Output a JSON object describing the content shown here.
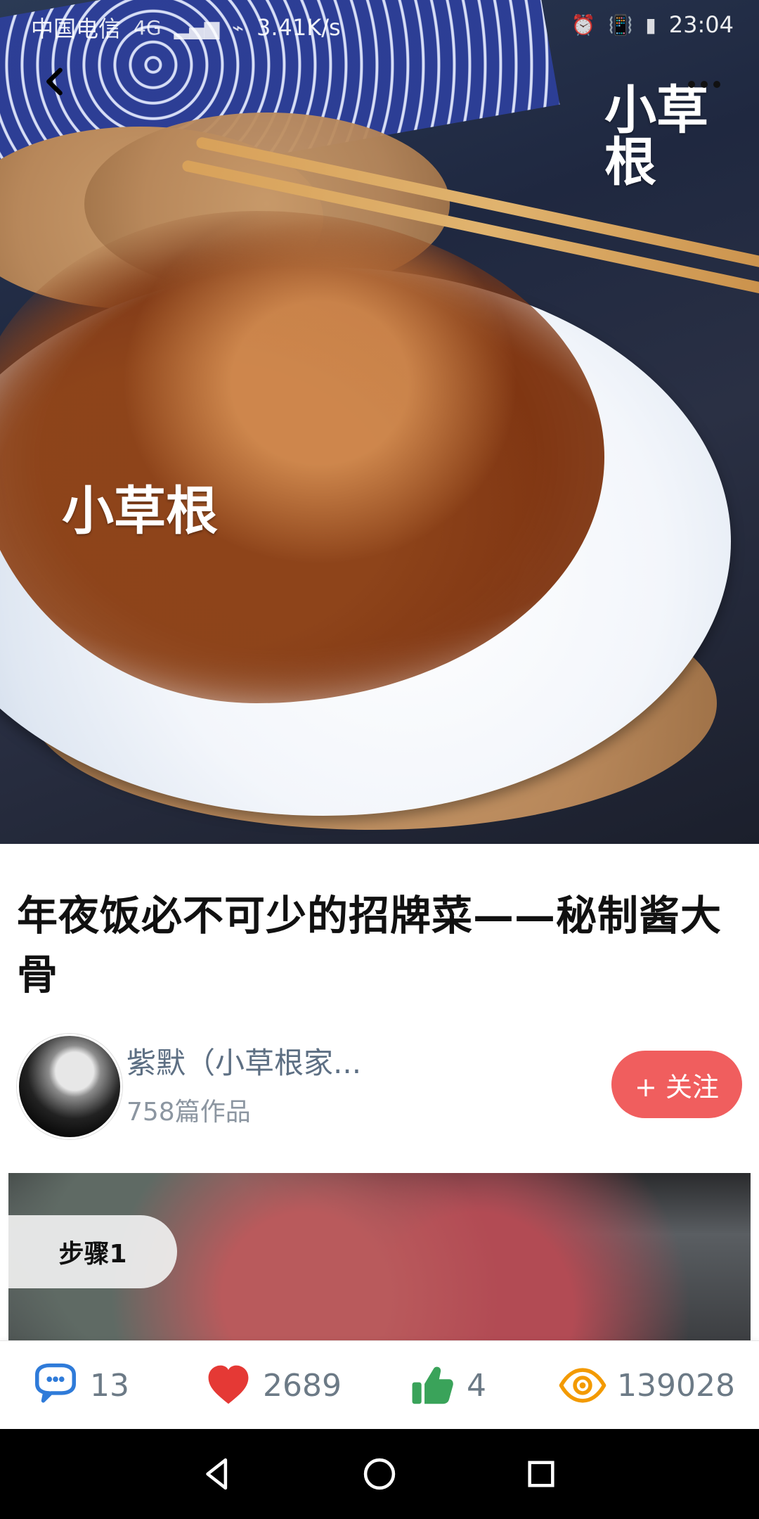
{
  "status_bar": {
    "carrier": "中国电信",
    "network": "4G",
    "speed": "3.41K/s",
    "time": "23:04"
  },
  "hero": {
    "watermark_text": "小草根"
  },
  "recipe": {
    "title": "年夜饭必不可少的招牌菜——秘制酱大骨"
  },
  "author": {
    "name": "紫默（小草根家...",
    "works": "758篇作品",
    "follow_label": "+ 关注"
  },
  "step": {
    "label": "步骤1"
  },
  "stats": {
    "comments": "13",
    "favorites": "2689",
    "likes": "4",
    "views": "139028"
  },
  "colors": {
    "follow_bg": "#f05e5e",
    "comment_icon": "#2f7bd9",
    "heart_icon": "#e53935",
    "like_icon": "#3aa35a",
    "eye_icon": "#f39a00"
  }
}
